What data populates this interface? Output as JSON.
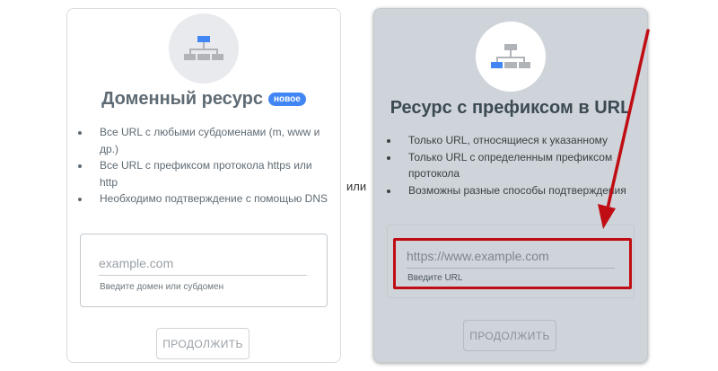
{
  "separator": "или",
  "domain_card": {
    "icon": "sitemap-icon",
    "title": "Доменный ресурс",
    "badge": "новое",
    "bullets": [
      "Все URL с любыми субдоменами (m, www и др.)",
      "Все URL с префиксом протокола https или http",
      "Необходимо подтверждение с помощью DNS"
    ],
    "input": {
      "placeholder": "example.com",
      "value": "",
      "hint": "Введите домен или субдомен"
    },
    "button_label": "ПРОДОЛЖИТЬ"
  },
  "prefix_card": {
    "icon": "sitemap-icon",
    "title": "Ресурс с префиксом в URL",
    "bullets": [
      "Только URL, относящиеся к указанному",
      "Только URL с определенным префиксом протокола",
      "Возможны разные способы подтверждения"
    ],
    "input": {
      "placeholder": "https://www.example.com",
      "value": "",
      "hint": "Введите URL"
    },
    "button_label": "ПРОДОЛЖИТЬ"
  },
  "annotation": {
    "color": "#c00d13",
    "arrow_icon": "red-arrow-icon"
  },
  "colors": {
    "accent_blue": "#4285f4",
    "selected_card_bg": "#ced4da"
  }
}
